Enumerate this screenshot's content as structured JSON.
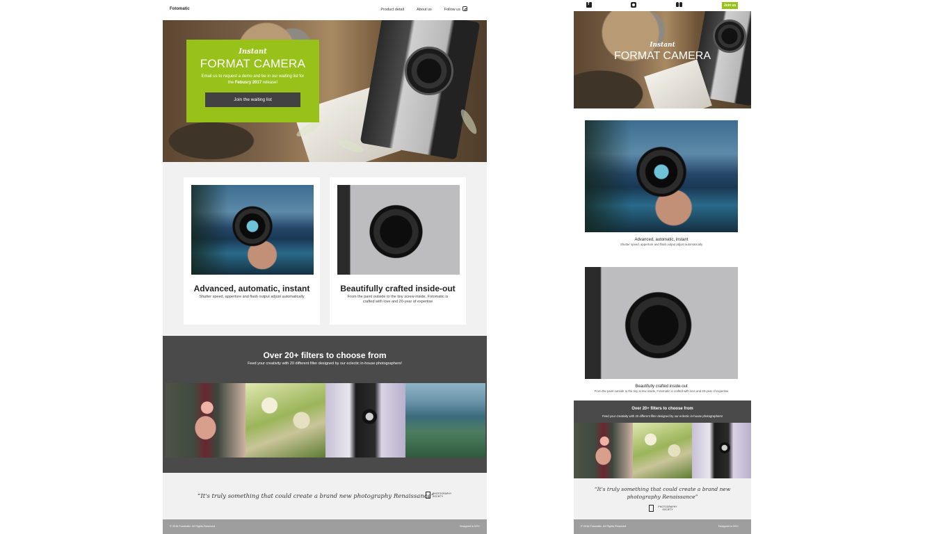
{
  "desktop": {
    "nav": {
      "brand": "Fotomatic",
      "links": [
        "Product detail",
        "About us",
        "Follow us"
      ]
    },
    "hero": {
      "script": "Instant",
      "title": "FORMAT CAMERA",
      "copy_pre": "Email us to request a demo and be in our waiting list for the ",
      "copy_bold": "Febusry 2017",
      "copy_post": " release!",
      "button": "Join the waiting list"
    },
    "features": [
      {
        "title": "Advanced, automatic, instant",
        "text": "Shutter speed, apperture and flash output adjust automatically"
      },
      {
        "title": "Beautifully crafted inside-out",
        "text": "From the paint outside to the tiny screw inside, Fotomatic is crafted with love and 20-year of expertise"
      }
    ],
    "filters": {
      "title": "Over 20+ filters to choose from",
      "text": "Feed your creativity with 20 different filter designed by our eclectic in-house photographers!"
    },
    "quote": {
      "text": "“It's truly something that could create a brand new photography Renaissance”",
      "society": "PHOTOGRAPHY SOCIETY"
    },
    "footer": {
      "left": "© 2016 Fotomatic. All Rights Reserved",
      "right": "Designed in NYC"
    }
  },
  "mobile": {
    "nav": {
      "join": "Join us",
      "icons": [
        "facebook-icon",
        "camera-icon",
        "people-icon"
      ]
    },
    "hero": {
      "script": "Instant",
      "title": "FORMAT CAMERA"
    },
    "features": [
      {
        "title": "Advanced, automatic, instant",
        "text": "Shutter speed, apperture and flash output adjust automatically"
      },
      {
        "title": "Beautifully crafted inside-out",
        "text": "From the paint outside to the tiny screw inside, Fotomatic is crafted with love and 20-year of expertise"
      }
    ],
    "filters": {
      "title": "Over 20+ filters to choose from",
      "text": "Feed your creativity with 20 different filter designed by our eclectic in-house photographers!"
    },
    "quote": {
      "text": "“It's truly something that could create a brand new photography Renaissance”",
      "society": "PHOTOGRAPHY SOCIETY"
    },
    "footer": {
      "left": "© 2016 Fotomatic. All Rights Reserved",
      "right": "Designed in NYC"
    }
  },
  "colors": {
    "accent": "#98c21a",
    "dark_band": "#4a4a4a",
    "footer": "#9e9e9e",
    "light_bg": "#f1f1f1"
  }
}
